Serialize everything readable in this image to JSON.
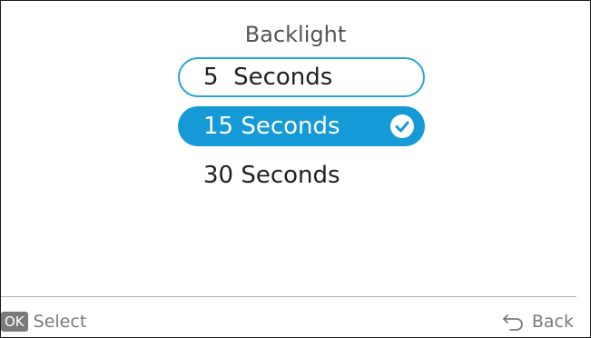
{
  "title": "Backlight",
  "options": [
    {
      "label": "5  Seconds",
      "state": "focused"
    },
    {
      "label": "15 Seconds",
      "state": "selected"
    },
    {
      "label": "30 Seconds",
      "state": "normal"
    }
  ],
  "footer": {
    "ok_badge": "OK",
    "select_label": "Select",
    "back_label": "Back",
    "back_icon": "back-arrow-icon"
  },
  "colors": {
    "accent": "#159ad7",
    "focus_border": "#2aa3d8",
    "muted_text": "#7a7a7a"
  }
}
